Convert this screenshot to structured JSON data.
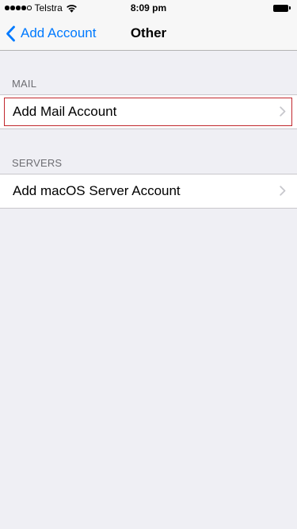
{
  "status_bar": {
    "carrier": "Telstra",
    "time": "8:09 pm",
    "signal_bars_filled": 4,
    "signal_bars_total": 5,
    "icons": [
      "signal-dots-icon",
      "wifi-icon",
      "battery-icon"
    ]
  },
  "nav": {
    "back_label": "Add Account",
    "title": "Other",
    "accent_color": "#007aff"
  },
  "sections": [
    {
      "header": "MAIL",
      "items": [
        {
          "label": "Add Mail Account",
          "highlighted": true
        }
      ]
    },
    {
      "header": "SERVERS",
      "items": [
        {
          "label": "Add macOS Server Account",
          "highlighted": false
        }
      ]
    }
  ],
  "highlight_color": "#c1272d"
}
